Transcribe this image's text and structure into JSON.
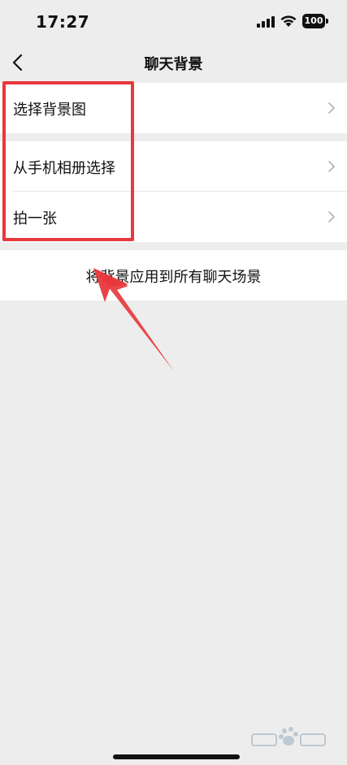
{
  "status_bar": {
    "time": "17:27",
    "battery": "100",
    "icons": [
      "signal-icon",
      "wifi-icon",
      "battery-icon"
    ]
  },
  "nav": {
    "title": "聊天背景",
    "back_icon": "chevron-left-icon"
  },
  "groups": [
    {
      "items": [
        {
          "label": "选择背景图",
          "icon": "chevron-right-icon"
        }
      ]
    },
    {
      "items": [
        {
          "label": "从手机相册选择",
          "icon": "chevron-right-icon"
        },
        {
          "label": "拍一张",
          "icon": "chevron-right-icon"
        }
      ]
    },
    {
      "items": [
        {
          "label": "将背景应用到所有聊天场景"
        }
      ]
    }
  ],
  "annotations": {
    "highlight_color": "#e8383d",
    "arrow_color": "#e8383d"
  },
  "watermark": {
    "logo": "baidu-jingyan-logo"
  },
  "colors": {
    "background": "#ededed",
    "cell": "#ffffff",
    "text": "#111111",
    "chevron": "#b2b2b2"
  }
}
